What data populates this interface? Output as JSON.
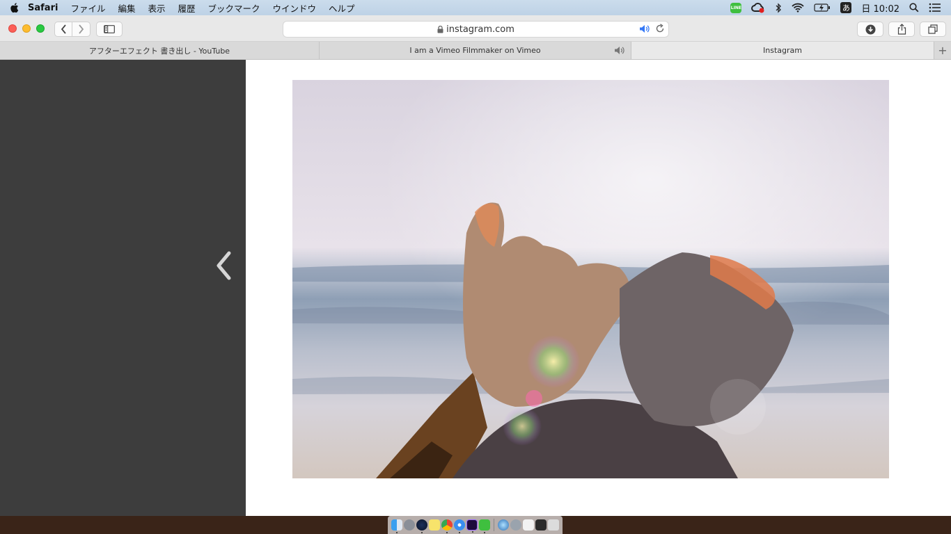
{
  "menubar": {
    "app_name": "Safari",
    "items": [
      "ファイル",
      "編集",
      "表示",
      "履歴",
      "ブックマーク",
      "ウインドウ",
      "ヘルプ"
    ],
    "line_badge": "LINE",
    "ime_label": "あ",
    "clock": "日 10:02",
    "icons": [
      "apple-icon",
      "line-icon",
      "creative-cloud-icon",
      "bluetooth-icon",
      "wifi-icon",
      "battery-icon",
      "input-method-icon",
      "spotlight-icon",
      "notification-center-icon"
    ]
  },
  "toolbar": {
    "url": "instagram.com",
    "icons": [
      "back-icon",
      "forward-icon",
      "sidebar-icon",
      "lock-icon",
      "speaker-icon",
      "reload-icon",
      "download-icon",
      "share-icon",
      "tabs-icon"
    ]
  },
  "tabs": [
    {
      "title": "アフターエフェクト 書き出し - YouTube",
      "active": false,
      "audio": false
    },
    {
      "title": "I am a Vimeo Filmmaker on Vimeo",
      "active": false,
      "audio": true
    },
    {
      "title": "Instagram",
      "active": true,
      "audio": false
    }
  ],
  "new_tab_label": "+",
  "content": {
    "photo_subject": "two hands pinky promise against sea and sky",
    "prev_icon": "chevron-left-icon"
  },
  "dock": {
    "icons": [
      "finder",
      "launchpad",
      "safari-alt",
      "notes",
      "chrome",
      "safari",
      "after-effects",
      "line",
      "preview",
      "system-preferences",
      "terminal",
      "trash"
    ]
  },
  "colors": {
    "menubar": "#c4d7ea",
    "toolbar": "#e8e8e8",
    "tab_bar": "#d9d9d9",
    "left_panel": "#3d3d3d",
    "accent_blue": "#3478f6"
  }
}
